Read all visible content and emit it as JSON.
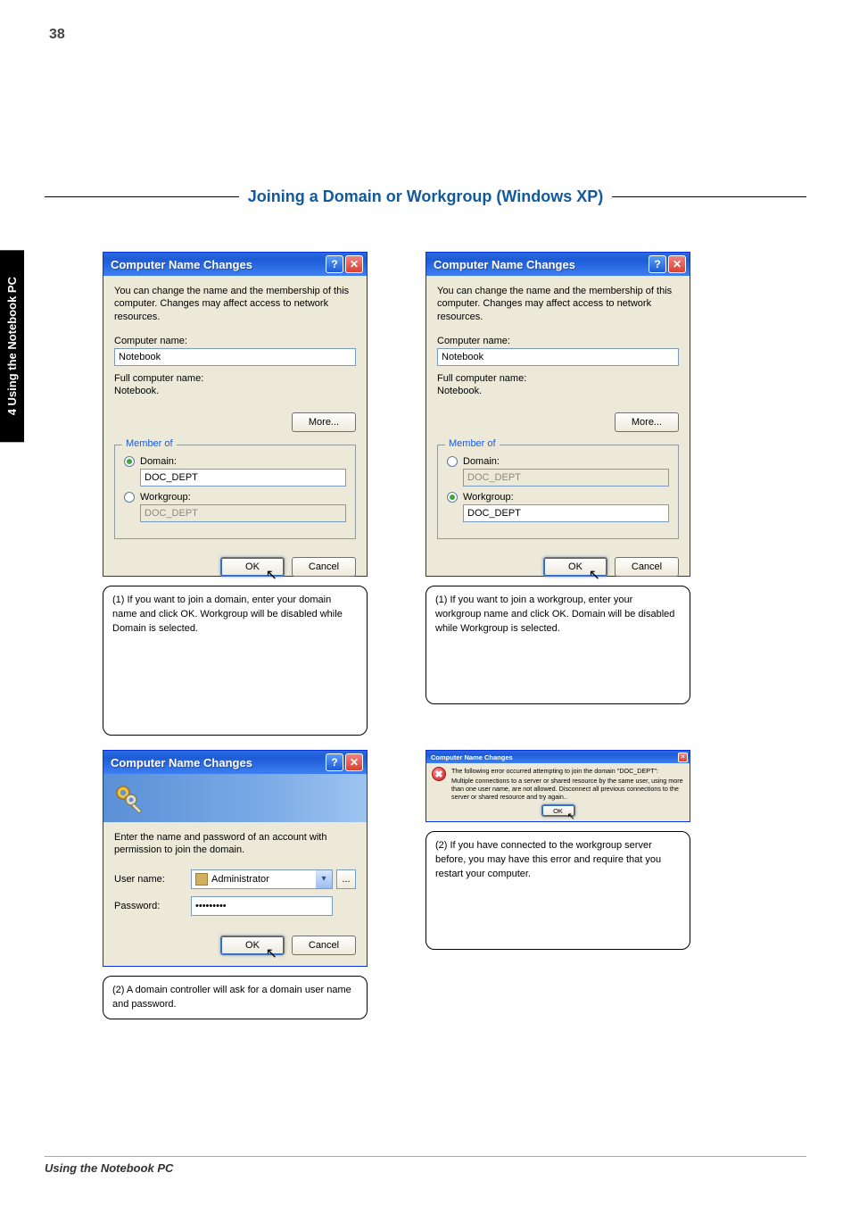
{
  "page_number": "38",
  "side_tab": "4 Using the Notebook PC",
  "section_heading": "Joining a Domain or Workgroup (Windows XP)",
  "dialog_main": {
    "title": "Computer Name Changes",
    "description": "You can change the name and the membership of this computer. Changes may affect access to network resources.",
    "computer_name_label": "Computer name:",
    "computer_name_value": "Notebook",
    "full_name_label": "Full computer name:",
    "full_name_value": "Notebook.",
    "more_button": "More...",
    "member_of_legend": "Member of",
    "domain_label": "Domain:",
    "workgroup_label": "Workgroup:",
    "doc_dept": "DOC_DEPT",
    "ok": "OK",
    "cancel": "Cancel"
  },
  "caption_domain": "(1) If you want to join a domain, enter your domain name and click OK. Workgroup will be disabled while Domain is selected.",
  "caption_workgroup": "(1) If you want to join a workgroup, enter your workgroup name and click OK. Domain will be disabled while Workgroup is selected.",
  "caption_cred": "(2) A domain controller will ask for a domain user name and password.",
  "caption_err": "(2) If you have connected to the workgroup server before, you may have this error and require that you restart your computer.",
  "cred_dialog": {
    "title": "Computer Name Changes",
    "instruction": "Enter the name and password of an account with permission to join the domain.",
    "username_label": "User name:",
    "username_value": "Administrator",
    "password_label": "Password:",
    "password_masked": "•••••••••",
    "ok": "OK",
    "cancel": "Cancel",
    "browse": "..."
  },
  "err_dialog": {
    "title": "Computer Name Changes",
    "line1": "The following error occurred attempting to join the domain \"DOC_DEPT\":",
    "line2": "Multiple connections to a server or shared resource by the same user, using more than one user name, are not allowed. Disconnect all previous connections to the server or shared resource and try again..",
    "ok": "OK"
  },
  "footer": "Using the Notebook PC"
}
